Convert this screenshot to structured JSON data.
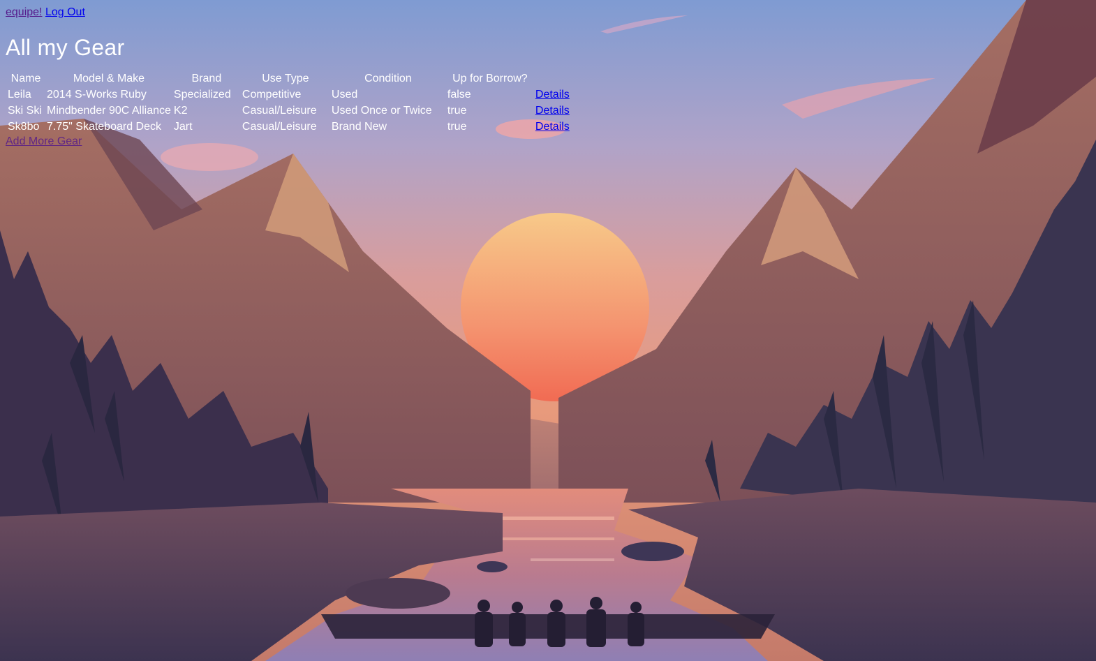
{
  "nav": {
    "brand": "equipe!",
    "logout": "Log Out"
  },
  "page": {
    "title": "All my Gear",
    "add_link": "Add More Gear"
  },
  "table": {
    "headers": {
      "name": "Name",
      "model": "Model & Make",
      "brand": "Brand",
      "use_type": "Use Type",
      "condition": "Condition",
      "borrow": "Up for Borrow?"
    },
    "rows": [
      {
        "name": "Leila",
        "model": "2014 S-Works Ruby",
        "brand": "Specialized",
        "use_type": "Competitive",
        "condition": "Used",
        "borrow": "false",
        "details": "Details"
      },
      {
        "name": "Ski Ski",
        "model": "Mindbender 90C Alliance",
        "brand": "K2",
        "use_type": "Casual/Leisure",
        "condition": "Used Once or Twice",
        "borrow": "true",
        "details": "Details"
      },
      {
        "name": "Sk8bo",
        "model": "7.75\" Skateboard Deck",
        "brand": "Jart",
        "use_type": "Casual/Leisure",
        "condition": "Brand New",
        "borrow": "true",
        "details": "Details"
      }
    ]
  },
  "colors": {
    "sky_top": "#7e9bd0",
    "sky_mid": "#d99a9a",
    "sun": "#f6b06e",
    "mountain": "#8d5a55",
    "forest": "#2d2b45",
    "visited_link": "#551a8b",
    "link": "#0000ee"
  }
}
